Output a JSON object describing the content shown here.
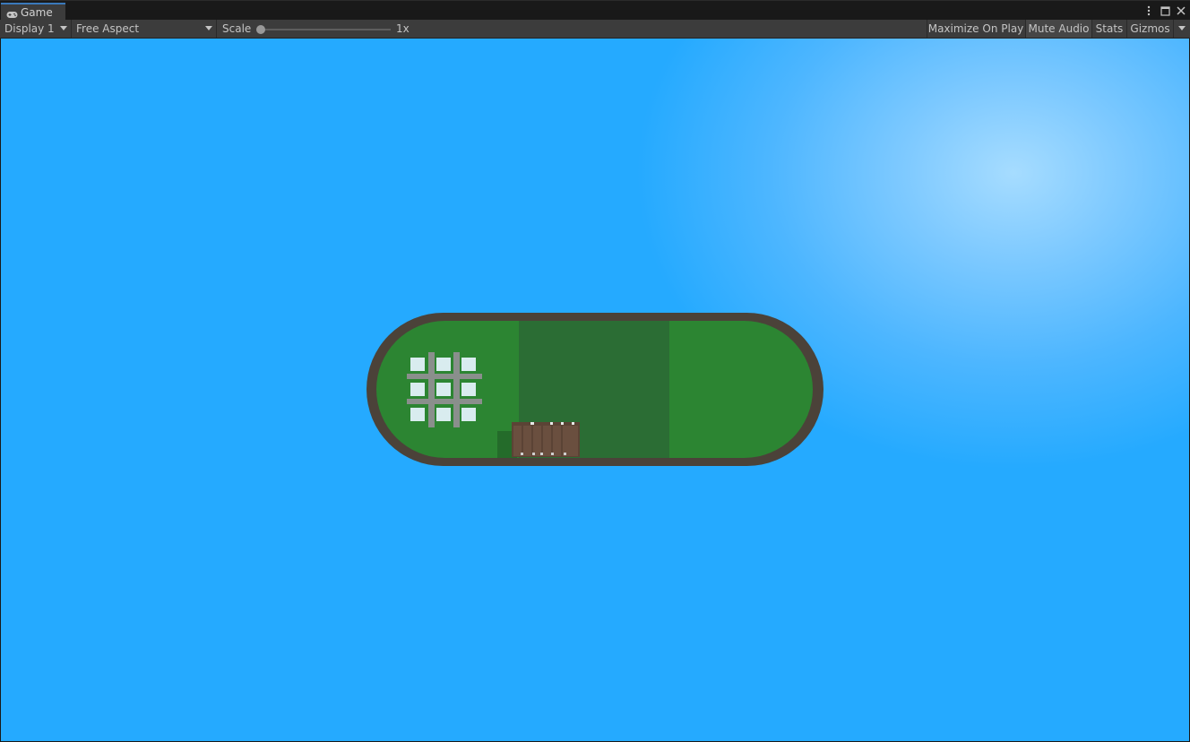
{
  "window": {
    "tab_label": "Game",
    "tab_icon": "gamepad-icon",
    "controls": [
      "more-options-icon",
      "maximize-icon",
      "close-icon"
    ]
  },
  "toolbar": {
    "display_label": "Display 1",
    "aspect_label": "Free Aspect",
    "scale_label": "Scale",
    "scale_value": "1x",
    "scale_level": 0.0,
    "maximize_on_play_label": "Maximize On Play",
    "mute_audio_label": "Mute Audio",
    "stats_label": "Stats",
    "gizmos_label": "Gizmos"
  },
  "colors": {
    "sky": "#25aaff",
    "sky_highlight": "#a6dcff",
    "track_border": "#4b4239",
    "field_green": "#2c8532",
    "center_zone": "#2b6d34",
    "building": "#d9ecef",
    "fence": "#5b4335",
    "accent_tab": "#3a79bb"
  }
}
